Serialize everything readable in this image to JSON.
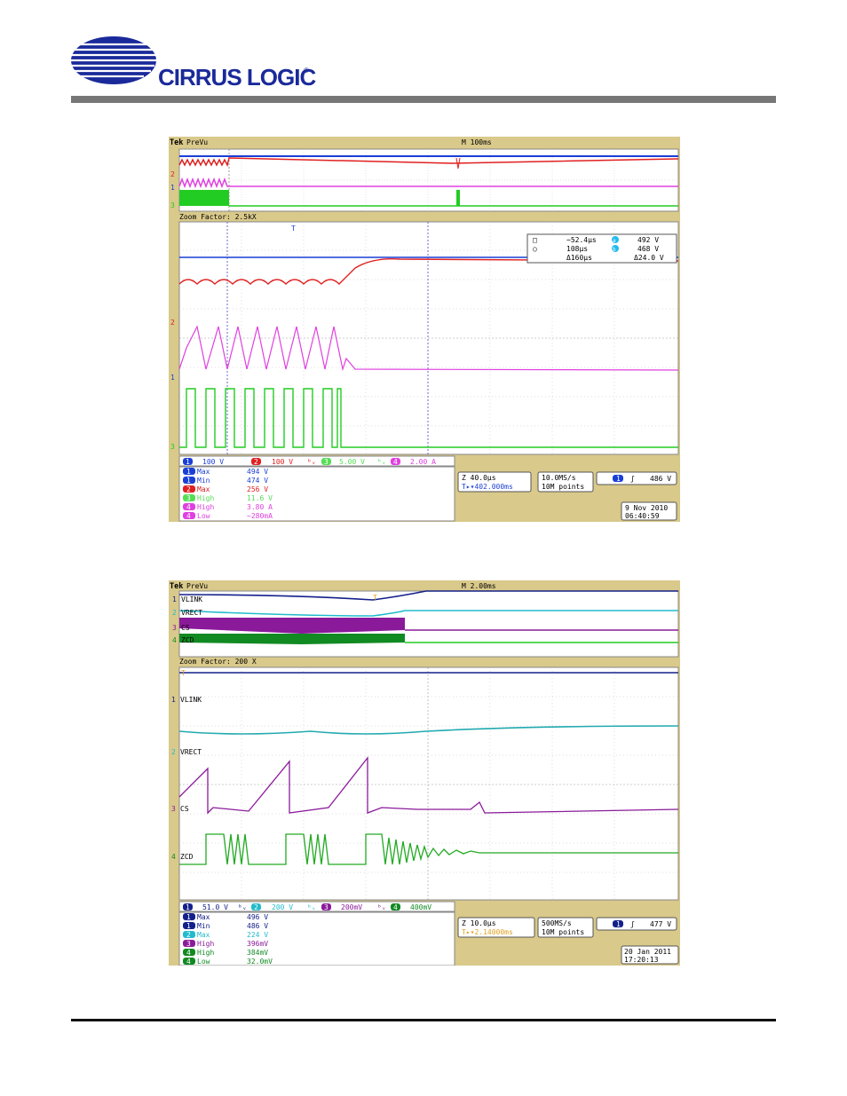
{
  "brand": {
    "name": "CIRRUS LOGIC",
    "mark": "®",
    "color": "#1a2a9a"
  },
  "scope1": {
    "header": {
      "tek": "Tek",
      "mode": "PreVu",
      "timebase": "M 100ms"
    },
    "zoom_factor": "Zoom Factor: 2.5kX",
    "cursor_box": {
      "t1": "−52.4µs",
      "t2": "108µs",
      "dt": "Δ160µs",
      "v1": "492 V",
      "v2": "468 V",
      "dv": "Δ24.0 V",
      "a_label": "a",
      "b_label": "b"
    },
    "channels": [
      {
        "num": "1",
        "scale": "100 V",
        "color": "#1a3fd6"
      },
      {
        "num": "2",
        "scale": "100 V",
        "color": "#e02020"
      },
      {
        "num": "3",
        "scale": "5.00 V",
        "color": "#22cc22"
      },
      {
        "num": "4",
        "scale": "2.00 A",
        "color": "#e040e0"
      }
    ],
    "bw_marker": "ᵇᵥ",
    "measurements": [
      {
        "ch": "1",
        "name": "Max",
        "value": "494 V",
        "color": "#1a3fd6"
      },
      {
        "ch": "1",
        "name": "Min",
        "value": "474 V",
        "color": "#1a3fd6"
      },
      {
        "ch": "2",
        "name": "Max",
        "value": "256 V",
        "color": "#e02020"
      },
      {
        "ch": "3",
        "name": "High",
        "value": "11.6 V",
        "color": "#55dd55"
      },
      {
        "ch": "4",
        "name": "High",
        "value": "3.80 A",
        "color": "#e040e0"
      },
      {
        "ch": "4",
        "name": "Low",
        "value": "−280mA",
        "color": "#e040e0"
      }
    ],
    "zoom_time": "Z 40.0µs",
    "zoom_pos": "T▸▾402.000ms",
    "rate": "10.0MS/s",
    "points": "10M points",
    "trigger": {
      "ch": "1",
      "slope": "ʃ",
      "level": "486 V"
    },
    "date": "9 Nov 2010",
    "time": "06:40:59"
  },
  "scope2": {
    "header": {
      "tek": "Tek",
      "mode": "PreVu",
      "timebase": "M 2.00ms"
    },
    "zoom_factor": "Zoom Factor: 200 X",
    "labels": [
      "VLINK",
      "VRECT",
      "CS",
      "ZCD"
    ],
    "channels": [
      {
        "num": "1",
        "scale": "51.0 V",
        "color": "#14208a"
      },
      {
        "num": "2",
        "scale": "200 V",
        "color": "#22bbcc"
      },
      {
        "num": "3",
        "scale": "200mV",
        "color": "#8a1a9a"
      },
      {
        "num": "4",
        "scale": "400mV",
        "color": "#118a22"
      }
    ],
    "bw_marker": "ᵇᵥ",
    "measurements": [
      {
        "ch": "1",
        "name": "Max",
        "value": "496 V",
        "color": "#14208a"
      },
      {
        "ch": "1",
        "name": "Min",
        "value": "486 V",
        "color": "#14208a"
      },
      {
        "ch": "2",
        "name": "Max",
        "value": "224 V",
        "color": "#22bbcc"
      },
      {
        "ch": "3",
        "name": "High",
        "value": "396mV",
        "color": "#8a1a9a"
      },
      {
        "ch": "4",
        "name": "High",
        "value": "384mV",
        "color": "#118a22"
      },
      {
        "ch": "4",
        "name": "Low",
        "value": "32.0mV",
        "color": "#118a22"
      }
    ],
    "zoom_time": "Z 10.0µs",
    "zoom_pos": "T▸▾2.14000ms",
    "rate": "500MS/s",
    "points": "10M points",
    "trigger": {
      "ch": "1",
      "slope": "ʃ",
      "level": "477 V"
    },
    "date": "20 Jan  2011",
    "time": "17:20:13"
  },
  "chart_data": [
    {
      "type": "line",
      "series": [
        {
          "name": "1",
          "description": "bus voltage ≈ 474–494 V, flat"
        },
        {
          "name": "2",
          "description": "rectified voltage ripple then rising to ~256 V plateau"
        },
        {
          "name": "4",
          "description": "triangular inductor current 0–3.80 A, 6 cycles then flat"
        },
        {
          "name": "3",
          "description": "gate square wave 0–11.6 V, 7 pulses then off"
        }
      ]
    },
    {
      "type": "line",
      "series": [
        {
          "name": "VLINK"
        },
        {
          "name": "VRECT"
        },
        {
          "name": "CS",
          "description": "sawtooth current sense ramps to 396mV, 3 cycles"
        },
        {
          "name": "ZCD",
          "description": "pulses 32.0mV–384mV then decaying ringing"
        }
      ]
    }
  ]
}
